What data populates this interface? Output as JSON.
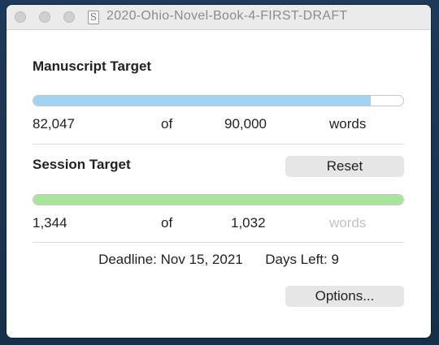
{
  "window": {
    "title": "2020-Ohio-Novel-Book-4-FIRST-DRAFT",
    "doc_icon": "S"
  },
  "manuscript": {
    "heading": "Manuscript Target",
    "current": "82,047",
    "of": "of",
    "target": "90,000",
    "unit": "words",
    "progress_fraction": 0.912,
    "bar_color": "#9fd3f2"
  },
  "session": {
    "heading": "Session Target",
    "reset_label": "Reset",
    "current": "1,344",
    "of": "of",
    "target": "1,032",
    "unit": "words",
    "progress_fraction": 1.0,
    "bar_color": "#a8e59c"
  },
  "footer": {
    "deadline": "Deadline: Nov 15, 2021",
    "days_left": "Days Left: 9",
    "options_label": "Options..."
  }
}
